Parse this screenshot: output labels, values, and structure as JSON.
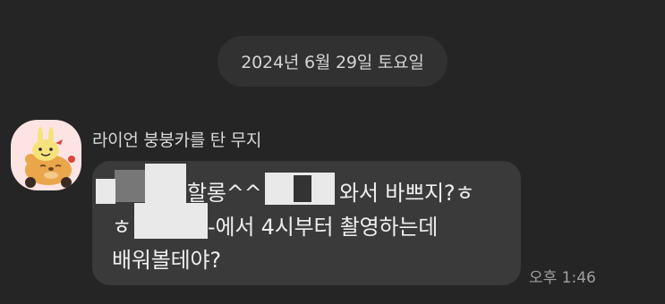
{
  "date_divider": "2024년 6월 29일 토요일",
  "sender": {
    "name": "라이언 붕붕카를 탄 무지",
    "avatar_icon": "muzi-riding-ryan-car-icon"
  },
  "message": {
    "line1_a": "할롱^^",
    "line1_b": "와서 바쁘지?ㅎ",
    "line2_a": "ㅎ",
    "line2_b": "-에서 4시부터 촬영하는데",
    "line3": "배워볼테야?"
  },
  "timestamp": "오후 1:46",
  "colors": {
    "background": "#252525",
    "bubble": "#3a3a3a",
    "date_pill": "#313131",
    "avatar_bg": "#fde4e2",
    "redaction": "#e9e9e9"
  }
}
